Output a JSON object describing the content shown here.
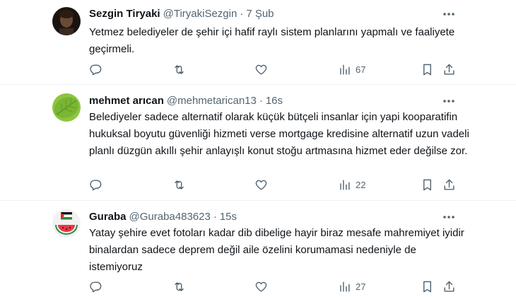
{
  "tweets": [
    {
      "author_name": "Sezgin Tiryaki",
      "handle": "@TiryakiSezgin",
      "separator": "·",
      "time": "7 Şub",
      "text": "Yetmez belediyeler de şehir içi hafif raylı sistem planlarını yapmalı ve faaliyete geçirmeli.",
      "views": "67",
      "avatar": "dark-portrait"
    },
    {
      "author_name": "mehmet arıcan",
      "handle": "@mehmetarican13",
      "separator": "·",
      "time": "16s",
      "text": "Belediyeler sadece alternatif olarak küçük bütçeli insanlar için yapi kooparatifin hukuksal boyutu güvenliği hizmeti verse mortgage kredisine alternatif uzun vadeli planlı düzgün akıllı şehir anlayışlı konut stoğu artmasına hizmet eder değilse zor.",
      "views": "22",
      "avatar": "green-leaf"
    },
    {
      "author_name": "Guraba",
      "handle": "@Guraba483623",
      "separator": "·",
      "time": "15s",
      "text": "Yatay şehire evet fotoları kadar dib dibelige hayir biraz mesafe mahremiyet iyidir binalardan sadece deprem değil aile özelini korumamasi nedeniyle de istemiyoruz",
      "views": "27",
      "avatar": "watermelon-flag"
    }
  ],
  "icons": {
    "more": "more-horizontal-icon",
    "reply": "reply-icon",
    "retweet": "retweet-icon",
    "like": "heart-icon",
    "views": "views-chart-icon",
    "bookmark": "bookmark-icon",
    "share": "share-icon"
  },
  "colors": {
    "text_primary": "#0f1419",
    "text_secondary": "#536471",
    "divider": "#eff3f4"
  }
}
